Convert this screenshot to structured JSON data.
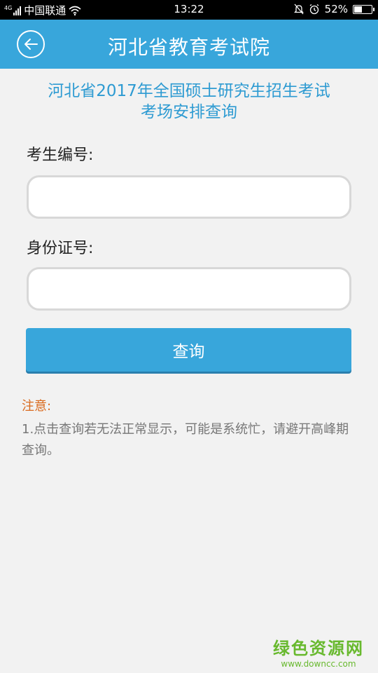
{
  "status_bar": {
    "network_tag": "4G",
    "carrier": "中国联通",
    "time": "13:22",
    "battery_text": "52%",
    "battery_level": 0.52,
    "icons": [
      "signal-icon",
      "wifi-icon",
      "bell-off-icon",
      "alarm-icon",
      "battery-icon"
    ]
  },
  "header": {
    "title": "河北省教育考试院",
    "background": "#38a6db"
  },
  "subtitle": {
    "line1": "河北省2017年全国硕士研究生招生考试",
    "line2": "考场安排查询"
  },
  "form": {
    "exam_id_label": "考生编号:",
    "exam_id_value": "",
    "id_card_label": "身份证号:",
    "id_card_value": "",
    "submit_label": "查询"
  },
  "notice": {
    "title": "注意:",
    "text": "1.点击查询若无法正常显示，可能是系统忙，请避开高峰期查询。"
  },
  "watermark": {
    "main": "绿色资源网",
    "url": "www.downcc.com"
  },
  "colors": {
    "accent": "#38a6db",
    "notice_title": "#d96a1e",
    "watermark": "#68b92e"
  }
}
